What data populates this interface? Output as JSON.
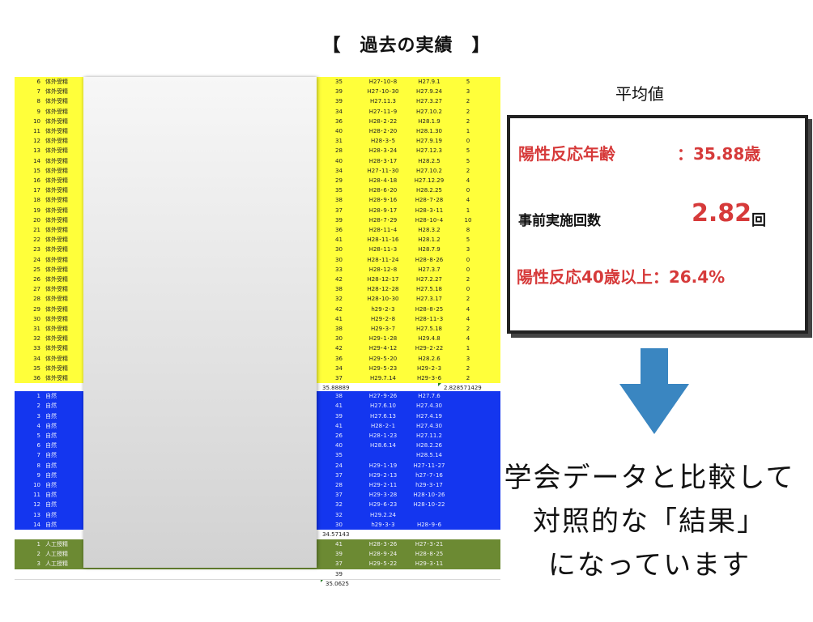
{
  "title": "【　過去の実績　】",
  "sheet": {
    "external": [
      {
        "num": "6",
        "label": "体外受精",
        "age": "35",
        "date1": "H27･10･8",
        "date2": "H27.9.1",
        "count": "5"
      },
      {
        "num": "7",
        "label": "体外受精",
        "age": "39",
        "date1": "H27･10･30",
        "date2": "H27.9.24",
        "count": "3"
      },
      {
        "num": "8",
        "label": "体外受精",
        "age": "39",
        "date1": "H27.11.3",
        "date2": "H27.3.27",
        "count": "2"
      },
      {
        "num": "9",
        "label": "体外受精",
        "age": "34",
        "date1": "H27･11･9",
        "date2": "H27.10.2",
        "count": "2"
      },
      {
        "num": "10",
        "label": "体外受精",
        "age": "36",
        "date1": "H28･2･22",
        "date2": "H28.1.9",
        "count": "2"
      },
      {
        "num": "11",
        "label": "体外受精",
        "age": "40",
        "date1": "H28･2･20",
        "date2": "H28.1.30",
        "count": "1"
      },
      {
        "num": "12",
        "label": "体外受精",
        "age": "31",
        "date1": "H28･3･5",
        "date2": "H27.9.19",
        "count": "0"
      },
      {
        "num": "13",
        "label": "体外受精",
        "age": "28",
        "date1": "H28･3･24",
        "date2": "H27.12.3",
        "count": "5"
      },
      {
        "num": "14",
        "label": "体外受精",
        "age": "40",
        "date1": "H28･3･17",
        "date2": "H28.2.5",
        "count": "5"
      },
      {
        "num": "15",
        "label": "体外受精",
        "age": "34",
        "date1": "H27･11･30",
        "date2": "H27.10.2",
        "count": "2"
      },
      {
        "num": "16",
        "label": "体外受精",
        "age": "29",
        "date1": "H28･4･18",
        "date2": "H27.12.29",
        "count": "4"
      },
      {
        "num": "17",
        "label": "体外受精",
        "age": "35",
        "date1": "H28･6･20",
        "date2": "H28.2.25",
        "count": "0"
      },
      {
        "num": "18",
        "label": "体外受精",
        "age": "38",
        "date1": "H28･9･16",
        "date2": "H28･7･28",
        "count": "4"
      },
      {
        "num": "19",
        "label": "体外受精",
        "age": "37",
        "date1": "H28･9･17",
        "date2": "H28･3･11",
        "count": "1"
      },
      {
        "num": "20",
        "label": "体外受精",
        "age": "39",
        "date1": "H28･7･29",
        "date2": "H28･10･4",
        "count": "10"
      },
      {
        "num": "21",
        "label": "体外受精",
        "age": "36",
        "date1": "H28･11･4",
        "date2": "H28.3.2",
        "count": "8"
      },
      {
        "num": "22",
        "label": "体外受精",
        "age": "41",
        "date1": "H28･11･16",
        "date2": "H28.1.2",
        "count": "5"
      },
      {
        "num": "23",
        "label": "体外受精",
        "age": "30",
        "date1": "H28･11･3",
        "date2": "H28.7.9",
        "count": "3"
      },
      {
        "num": "24",
        "label": "体外受精",
        "age": "30",
        "date1": "H28･11･24",
        "date2": "H28･8･26",
        "count": "0"
      },
      {
        "num": "25",
        "label": "体外受精",
        "age": "33",
        "date1": "H28･12･8",
        "date2": "H27.3.7",
        "count": "0"
      },
      {
        "num": "26",
        "label": "体外受精",
        "age": "42",
        "date1": "H28･12･17",
        "date2": "H27.2.27",
        "count": "2"
      },
      {
        "num": "27",
        "label": "体外受精",
        "age": "38",
        "date1": "H28･12･28",
        "date2": "H27.5.18",
        "count": "0"
      },
      {
        "num": "28",
        "label": "体外受精",
        "age": "32",
        "date1": "H28･10･30",
        "date2": "H27.3.17",
        "count": "2"
      },
      {
        "num": "29",
        "label": "体外受精",
        "age": "42",
        "date1": "h29･2･3",
        "date2": "H28･8･25",
        "count": "4"
      },
      {
        "num": "30",
        "label": "体外受精",
        "age": "41",
        "date1": "H29･2･8",
        "date2": "H28･11･3",
        "count": "4"
      },
      {
        "num": "31",
        "label": "体外受精",
        "age": "38",
        "date1": "H29･3･7",
        "date2": "H27.5.18",
        "count": "2"
      },
      {
        "num": "32",
        "label": "体外受精",
        "age": "30",
        "date1": "H29･1･28",
        "date2": "H29.4.8",
        "count": "4"
      },
      {
        "num": "33",
        "label": "体外受精",
        "age": "42",
        "date1": "H29･4･12",
        "date2": "H29･2･22",
        "count": "1"
      },
      {
        "num": "34",
        "label": "体外受精",
        "age": "36",
        "date1": "H29･5･20",
        "date2": "H28.2.6",
        "count": "3"
      },
      {
        "num": "35",
        "label": "体外受精",
        "age": "34",
        "date1": "H29･5･23",
        "date2": "H29･2･3",
        "count": "2"
      },
      {
        "num": "36",
        "label": "体外受精",
        "age": "37",
        "date1": "H29.7.14",
        "date2": "H29･3･6",
        "count": "2"
      }
    ],
    "external_avg": {
      "age": "35.88889",
      "count": "2.828571429"
    },
    "natural": [
      {
        "num": "1",
        "label": "自然",
        "age": "38",
        "date1": "H27･9･26",
        "date2": "H27.7.6",
        "count": ""
      },
      {
        "num": "2",
        "label": "自然",
        "age": "41",
        "date1": "H27.6.10",
        "date2": "H27.4.30",
        "count": ""
      },
      {
        "num": "3",
        "label": "自然",
        "age": "39",
        "date1": "H27.6.13",
        "date2": "H27.4.19",
        "count": ""
      },
      {
        "num": "4",
        "label": "自然",
        "age": "41",
        "date1": "H28･2･1",
        "date2": "H27.4.30",
        "count": ""
      },
      {
        "num": "5",
        "label": "自然",
        "age": "26",
        "date1": "H28･1･23",
        "date2": "H27.11.2",
        "count": ""
      },
      {
        "num": "6",
        "label": "自然",
        "age": "40",
        "date1": "H28.6.14",
        "date2": "H28.2.26",
        "count": ""
      },
      {
        "num": "7",
        "label": "自然",
        "age": "35",
        "date1": "",
        "date2": "H28.5.14",
        "count": ""
      },
      {
        "num": "8",
        "label": "自然",
        "age": "24",
        "date1": "H29･1･19",
        "date2": "H27･11･27",
        "count": ""
      },
      {
        "num": "9",
        "label": "自然",
        "age": "37",
        "date1": "H29･2･13",
        "date2": "h27･7･16",
        "count": ""
      },
      {
        "num": "10",
        "label": "自然",
        "age": "28",
        "date1": "H29･2･11",
        "date2": "h29･3･17",
        "count": ""
      },
      {
        "num": "11",
        "label": "自然",
        "age": "37",
        "date1": "H29･3･28",
        "date2": "H28･10･26",
        "count": ""
      },
      {
        "num": "12",
        "label": "自然",
        "age": "32",
        "date1": "H29･6･23",
        "date2": "H28･10･22",
        "count": ""
      },
      {
        "num": "13",
        "label": "自然",
        "age": "32",
        "date1": "H29.2.24",
        "date2": "",
        "count": ""
      },
      {
        "num": "14",
        "label": "自然",
        "age": "30",
        "date1": "h29･3･3",
        "date2": "H28･9･6",
        "count": ""
      }
    ],
    "natural_avg": {
      "age": "34.57143"
    },
    "artificial": [
      {
        "num": "1",
        "label": "人工授精",
        "age": "41",
        "date1": "H28･3･26",
        "date2": "H27･3･21",
        "count": ""
      },
      {
        "num": "2",
        "label": "人工授精",
        "age": "39",
        "date1": "H28･9･24",
        "date2": "H28･8･25",
        "count": ""
      },
      {
        "num": "3",
        "label": "人工授精",
        "age": "37",
        "date1": "H29･5･22",
        "date2": "H29･3･11",
        "count": ""
      }
    ],
    "artificial_extra": {
      "age": "39"
    },
    "artificial_avg": {
      "age": "35.0625"
    }
  },
  "colors": {
    "external": "#ffff3a",
    "natural": "#1436ef",
    "artificial": "#6c8a33",
    "accent": "#d63a3a",
    "arrow": "#3a86c1"
  },
  "average": {
    "heading": "平均値",
    "age_label": "陽性反応年齢",
    "age_value": "：35.88歳",
    "prior_label": "事前実施回数",
    "prior_value": "2.82",
    "prior_unit": "回",
    "over40_label": "陽性反応40歳以上：26.4%"
  },
  "message": {
    "line1": "学会データと比較して",
    "line2": "対照的な「結果」",
    "line3": "になっています"
  }
}
